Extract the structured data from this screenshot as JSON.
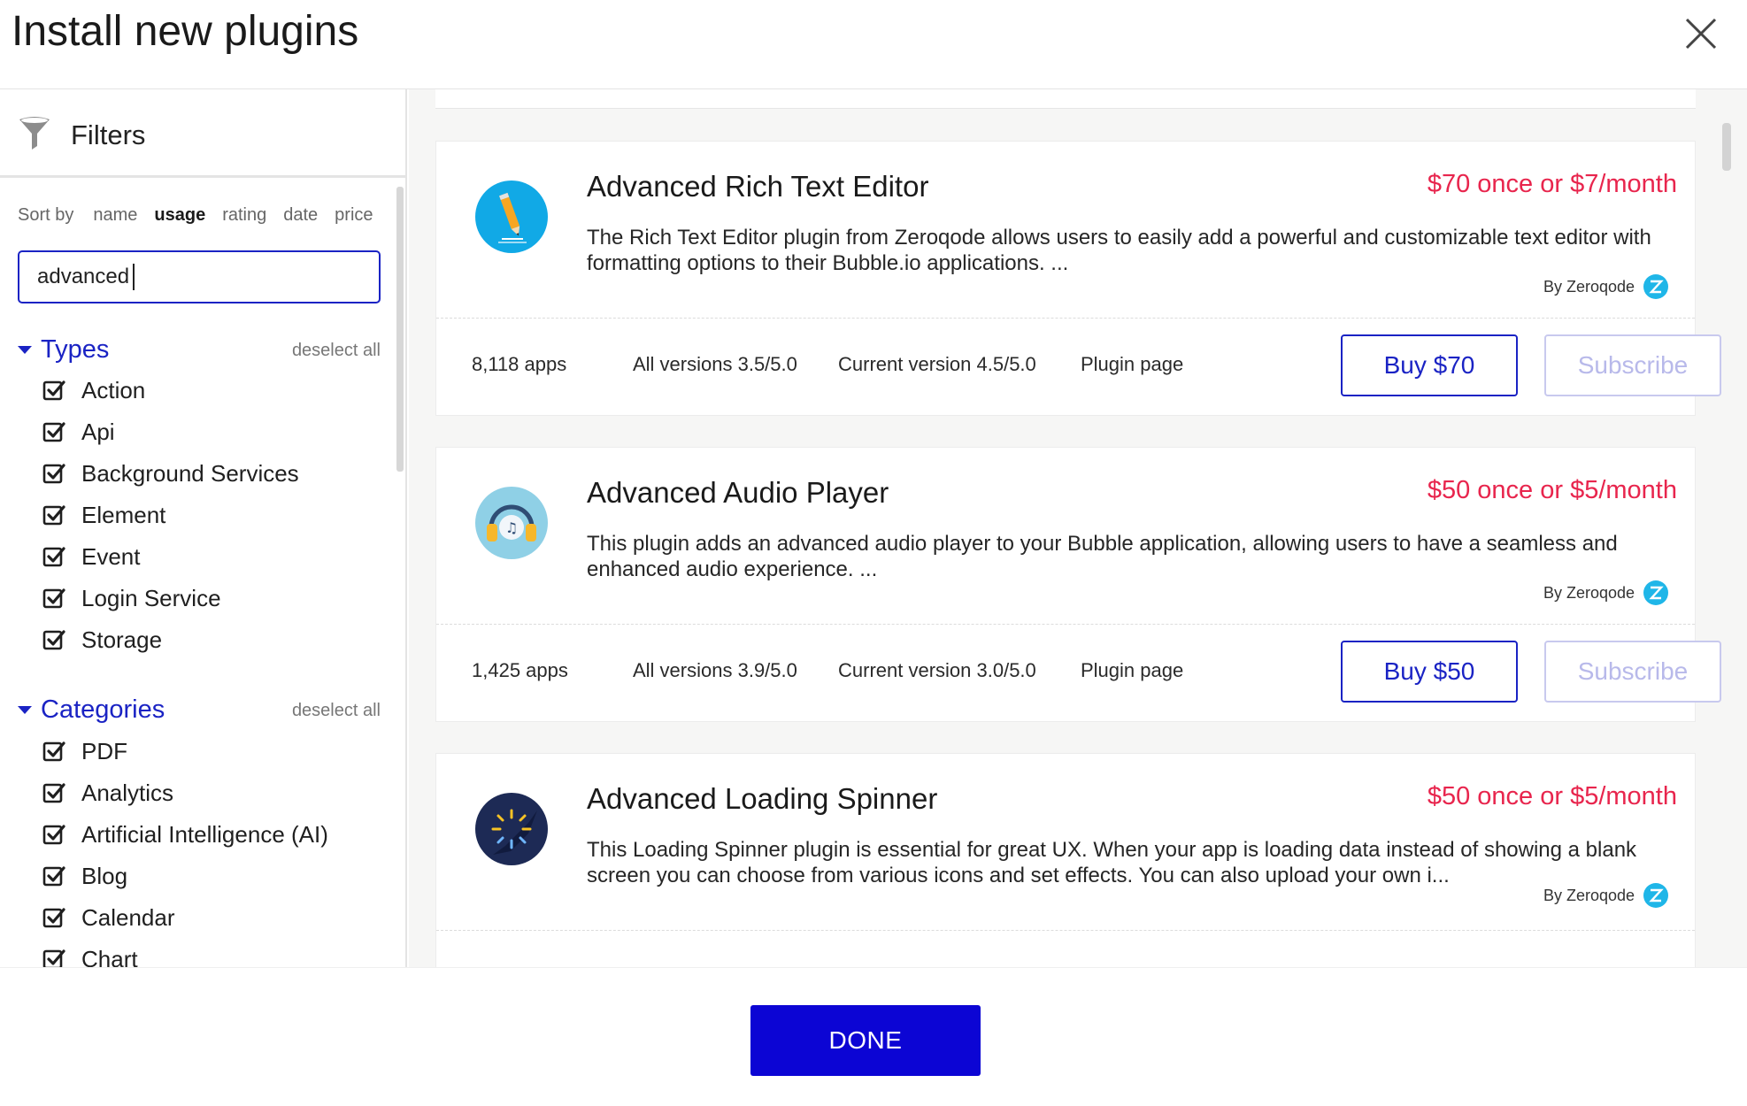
{
  "header": {
    "title": "Install new plugins"
  },
  "filters": {
    "label": "Filters",
    "sort_label": "Sort by",
    "sort_options": [
      "name",
      "usage",
      "rating",
      "date",
      "price"
    ],
    "sort_active": "usage",
    "search_value": "advanced",
    "types": {
      "title": "Types",
      "deselect": "deselect all",
      "items": [
        "Action",
        "Api",
        "Background Services",
        "Element",
        "Event",
        "Login Service",
        "Storage"
      ]
    },
    "categories": {
      "title": "Categories",
      "deselect": "deselect all",
      "items": [
        "PDF",
        "Analytics",
        "Artificial Intelligence (AI)",
        "Blog",
        "Calendar",
        "Chart"
      ]
    }
  },
  "plugins": [
    {
      "title": "Advanced Rich Text Editor",
      "price": "$70 once or $7/month",
      "description": "The Rich Text Editor plugin from Zeroqode allows users to easily add a powerful and customizable text editor with formatting options to their Bubble.io applications. ...",
      "author": "By Zeroqode",
      "apps": "8,118 apps",
      "all_versions": "All versions 3.5/5.0",
      "current_version": "Current version 4.5/5.0",
      "plugin_page": "Plugin page",
      "buy": "Buy $70",
      "subscribe": "Subscribe",
      "icon": "pencil-icon"
    },
    {
      "title": "Advanced Audio Player",
      "price": "$50 once or $5/month",
      "description": "This plugin adds an advanced audio player to your Bubble application, allowing users to have a seamless and enhanced audio experience. ...",
      "author": "By Zeroqode",
      "apps": "1,425 apps",
      "all_versions": "All versions 3.9/5.0",
      "current_version": "Current version 3.0/5.0",
      "plugin_page": "Plugin page",
      "buy": "Buy $50",
      "subscribe": "Subscribe",
      "icon": "headphones-icon"
    },
    {
      "title": "Advanced Loading Spinner",
      "price": "$50 once or $5/month",
      "description": "This Loading Spinner plugin is essential for great UX. When your app is loading data instead of showing a blank screen you can choose from various icons and set effects. You can also upload your own i...",
      "author": "By Zeroqode",
      "icon": "spinner-icon"
    }
  ],
  "footer": {
    "done": "DONE"
  },
  "colors": {
    "accent": "#1a23c4",
    "price": "#e8254d",
    "done_bg": "#0c05d4",
    "zeroqode": "#1fb6e8"
  }
}
